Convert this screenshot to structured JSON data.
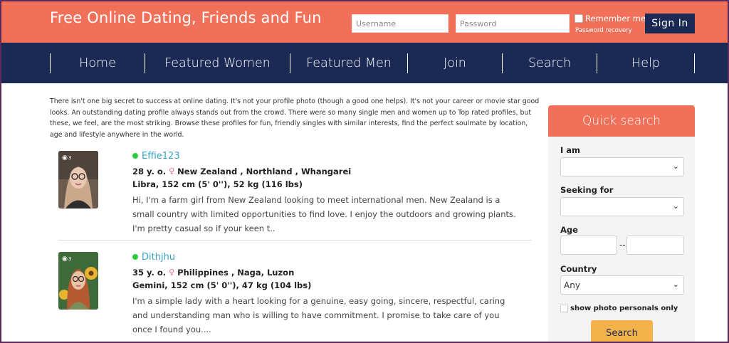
{
  "header": {
    "title": "Free Online Dating, Friends and Fun",
    "username_placeholder": "Username",
    "password_placeholder": "Password",
    "remember_label": "Remember me",
    "recovery_label": "Password recovery",
    "signin_label": "Sign In"
  },
  "nav": {
    "items": [
      "Home",
      "Featured Women",
      "Featured Men",
      "Join",
      "Search",
      "Help"
    ]
  },
  "intro": "There isn't one big secret to success at online dating. It's not your profile photo (though a good one helps). It's not your career or movie star good looks. An outstanding dating profile always stands out from the crowd. There were so many single men and women up to Top rated profiles, but these, we feel, are the most striking. Browse these profiles for fun, friendly singles with similar interests, find the perfect soulmate by location, age and lifestyle anywhere in the world.",
  "profiles": [
    {
      "username": "Effie123",
      "age": "28 y. o.",
      "location": "New Zealand , Northland , Whangarei",
      "details": "Libra, 152 cm (5' 0''), 52 kg (116 lbs)",
      "photo_count": "3",
      "description": "Hi, I'm a farm girl from New Zealand looking to meet international men. New Zealand is a small country with limited opportunities to find love. I enjoy the outdoors and growing plants. I'm pretty casual so if your keen t.."
    },
    {
      "username": "Dithjhu",
      "age": "35 y. o.",
      "location": "Philippines , Naga, Luzon",
      "details": "Gemini, 152 cm (5' 0''), 47 kg (104 lbs)",
      "photo_count": "3",
      "description": "I'm a simple lady with a heart looking for a genuine, easy going, sincere, respectful, caring and understanding man who is willing to have commitment. I promise to take care of you once I found you...."
    }
  ],
  "quick_search": {
    "title": "Quick search",
    "i_am_label": "I am",
    "seeking_label": "Seeking for",
    "age_label": "Age",
    "age_separator": "--",
    "country_label": "Country",
    "country_value": "Any",
    "photo_only_label": "show photo personals only",
    "button_label": "Search"
  },
  "colors": {
    "header_bg": "#f0705a",
    "nav_bg": "#1a2a55",
    "link": "#3aa2c2",
    "online": "#2ecc40",
    "search_button": "#f5b14a"
  }
}
